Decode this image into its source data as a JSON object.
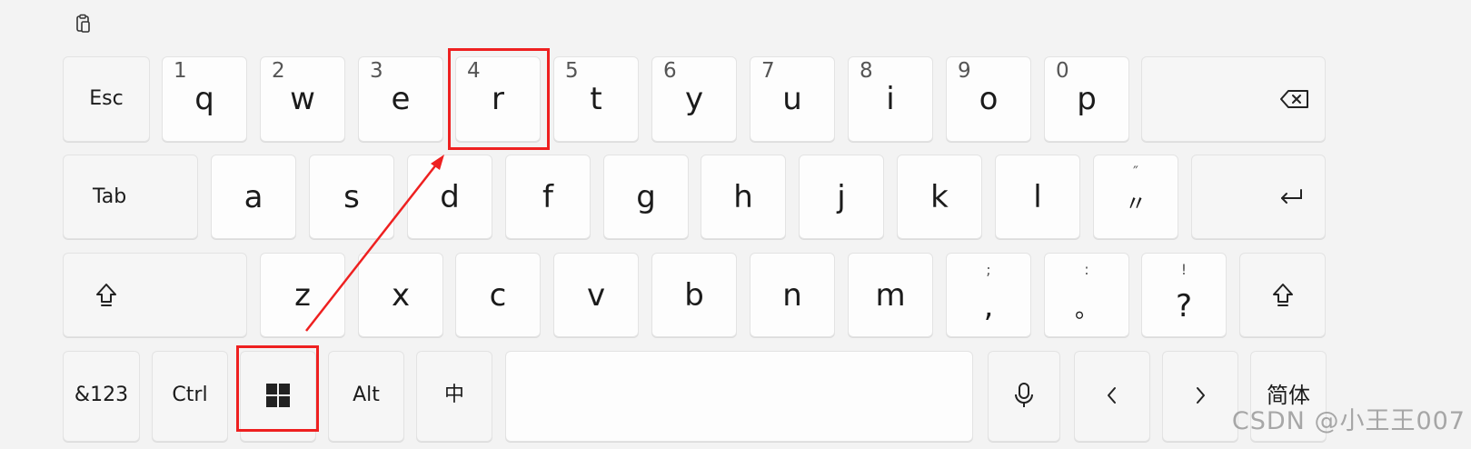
{
  "toolbar": {
    "clipboard_icon": "clipboard-icon"
  },
  "row1": {
    "esc_label": "Esc",
    "keys": [
      {
        "main": "q",
        "sec": "1"
      },
      {
        "main": "w",
        "sec": "2"
      },
      {
        "main": "e",
        "sec": "3"
      },
      {
        "main": "r",
        "sec": "4"
      },
      {
        "main": "t",
        "sec": "5"
      },
      {
        "main": "y",
        "sec": "6"
      },
      {
        "main": "u",
        "sec": "7"
      },
      {
        "main": "i",
        "sec": "8"
      },
      {
        "main": "o",
        "sec": "9"
      },
      {
        "main": "p",
        "sec": "0"
      }
    ],
    "backspace_icon": "backspace-icon"
  },
  "row2": {
    "tab_label": "Tab",
    "keys": [
      "a",
      "s",
      "d",
      "f",
      "g",
      "h",
      "j",
      "k",
      "l"
    ],
    "quote": {
      "top": "″",
      "main": "〃"
    },
    "enter_icon": "enter-icon"
  },
  "row3": {
    "shift_icon": "shift-icon",
    "keys": [
      "z",
      "x",
      "c",
      "v",
      "b",
      "n",
      "m"
    ],
    "comma": {
      "top": ";",
      "main": ","
    },
    "period": {
      "top": ":",
      "main": "。"
    },
    "question": {
      "top": "!",
      "main": "?"
    }
  },
  "row4": {
    "symbols_label": "&123",
    "ctrl_label": "Ctrl",
    "windows_icon": "windows-logo-icon",
    "alt_label": "Alt",
    "ime_label": "中",
    "mic_icon": "microphone-icon",
    "left_icon": "chevron-left-icon",
    "right_icon": "chevron-right-icon",
    "simplified_label": "简体"
  },
  "watermark": "CSDN @小王王007",
  "annotation_color": "#ee2020"
}
